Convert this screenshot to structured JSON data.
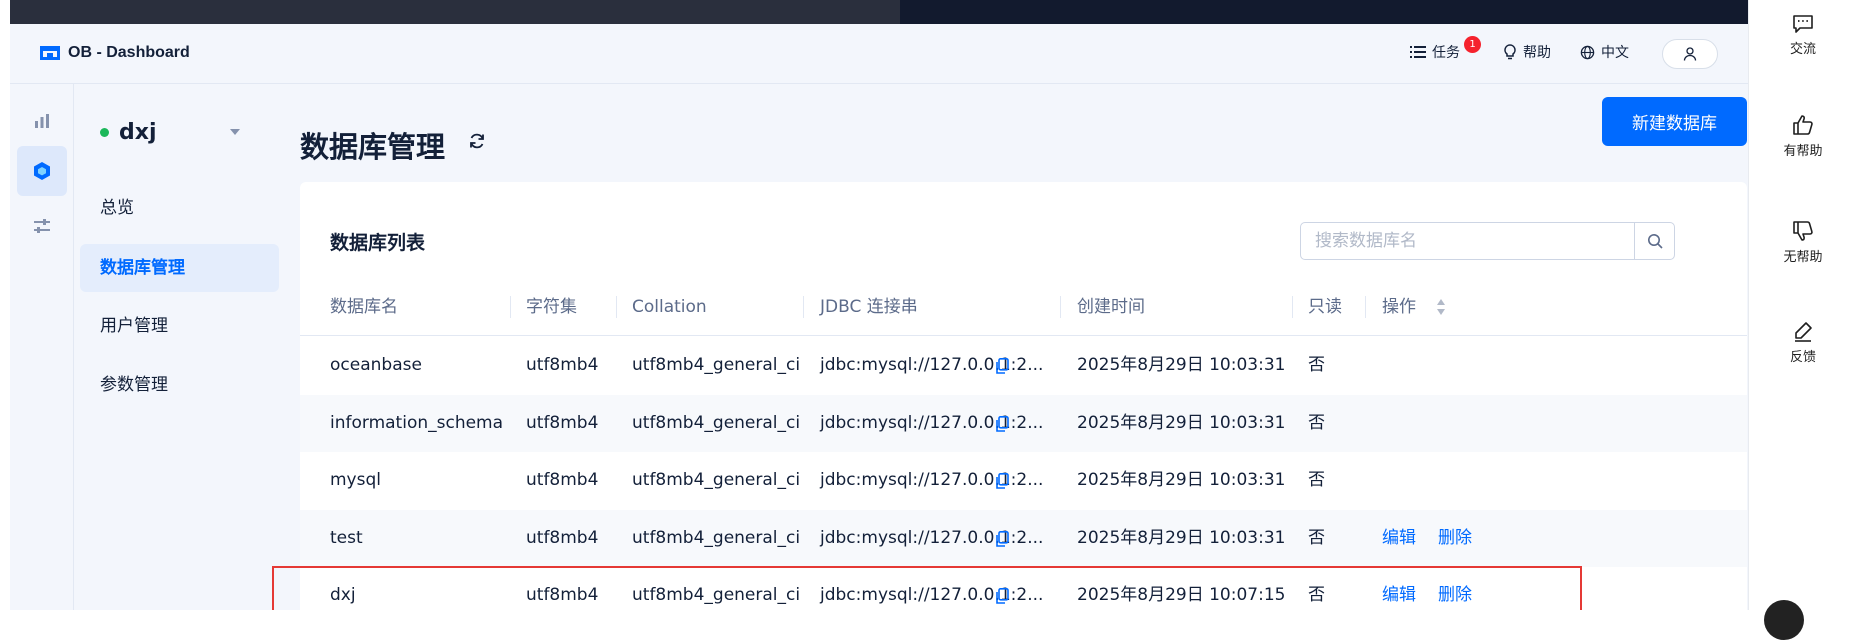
{
  "app": {
    "title": "OB - Dashboard"
  },
  "header": {
    "tasks_label": "任务",
    "tasks_badge": "1",
    "help_label": "帮助",
    "language_label": "中文"
  },
  "sidebar": {
    "cluster_name": "dxj",
    "items": [
      {
        "label": "总览",
        "active": false
      },
      {
        "label": "数据库管理",
        "active": true
      },
      {
        "label": "用户管理",
        "active": false
      },
      {
        "label": "参数管理",
        "active": false
      }
    ]
  },
  "page": {
    "title": "数据库管理",
    "new_button": "新建数据库"
  },
  "card": {
    "title": "数据库列表",
    "search_placeholder": "搜索数据库名"
  },
  "table": {
    "columns": [
      "数据库名",
      "字符集",
      "Collation",
      "JDBC 连接串",
      "创建时间",
      "只读",
      "操作"
    ],
    "rows": [
      {
        "name": "oceanbase",
        "charset": "utf8mb4",
        "collation": "utf8mb4_general_ci",
        "jdbc": "jdbc:mysql://127.0.0.1:2...",
        "created": "2025年8月29日 10:03:31",
        "readonly": "否",
        "edit": "",
        "delete": ""
      },
      {
        "name": "information_schema",
        "charset": "utf8mb4",
        "collation": "utf8mb4_general_ci",
        "jdbc": "jdbc:mysql://127.0.0.1:2...",
        "created": "2025年8月29日 10:03:31",
        "readonly": "否",
        "edit": "",
        "delete": ""
      },
      {
        "name": "mysql",
        "charset": "utf8mb4",
        "collation": "utf8mb4_general_ci",
        "jdbc": "jdbc:mysql://127.0.0.1:2...",
        "created": "2025年8月29日 10:03:31",
        "readonly": "否",
        "edit": "",
        "delete": ""
      },
      {
        "name": "test",
        "charset": "utf8mb4",
        "collation": "utf8mb4_general_ci",
        "jdbc": "jdbc:mysql://127.0.0.1:2...",
        "created": "2025年8月29日 10:03:31",
        "readonly": "否",
        "edit": "编辑",
        "delete": "删除"
      },
      {
        "name": "dxj",
        "charset": "utf8mb4",
        "collation": "utf8mb4_general_ci",
        "jdbc": "jdbc:mysql://127.0.0.1:2...",
        "created": "2025年8月29日 10:07:15",
        "readonly": "否",
        "edit": "编辑",
        "delete": "删除"
      }
    ]
  },
  "feedback_panel": {
    "items": [
      "交流",
      "有帮助",
      "无帮助",
      "反馈"
    ]
  },
  "colors": {
    "primary": "#006aff",
    "highlight_border": "#e53935",
    "status_dot": "#1bb75a",
    "badge": "#f5222d"
  }
}
